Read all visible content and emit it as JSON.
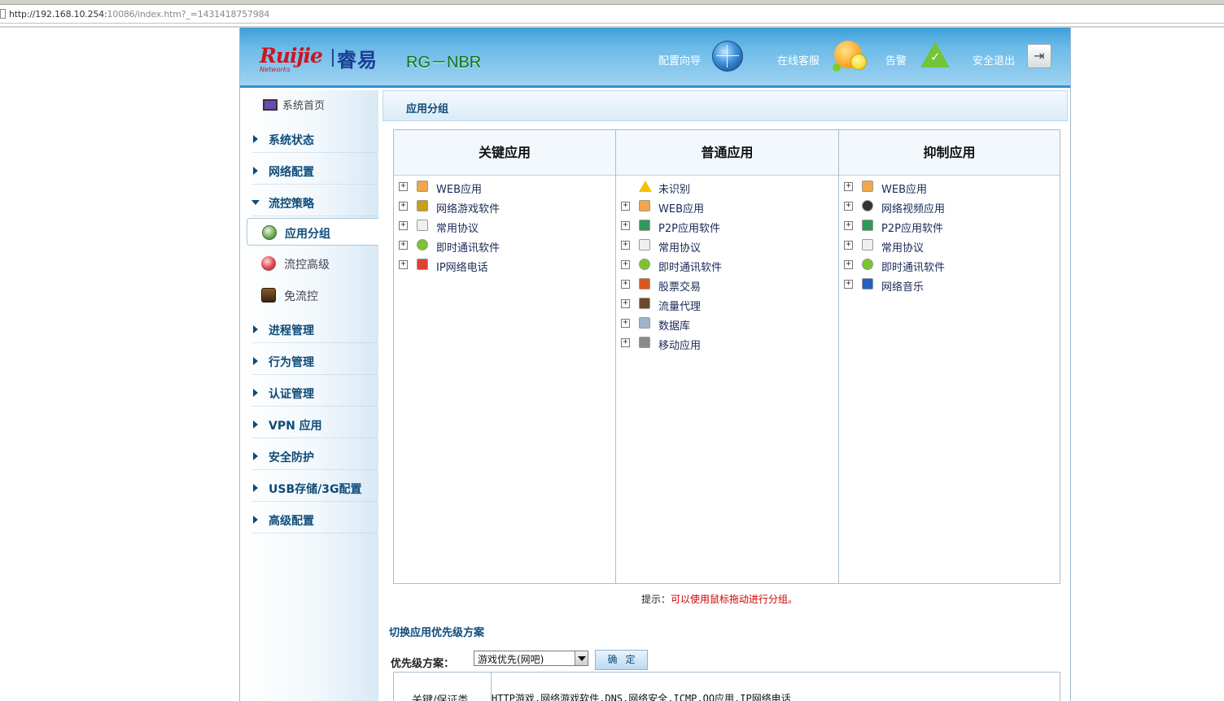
{
  "browser": {
    "url_prefix": "http://192.168.10.254:",
    "url_suffix": "10086/index.htm?_=1431418757984"
  },
  "header": {
    "brand_latin": "Ruijie",
    "brand_sub": "Networks",
    "brand_cn": "睿易",
    "model": "RG－NBR",
    "nav": {
      "wizard": "配置向导",
      "support": "在线客服",
      "alert": "告警",
      "logout": "安全退出"
    },
    "icons": [
      "globe-icon",
      "smiley-icon",
      "alert-check-icon",
      "exit-door-icon"
    ]
  },
  "sidebar": {
    "home": "系统首页",
    "items": [
      {
        "label": "系统状态"
      },
      {
        "label": "网络配置"
      },
      {
        "label": "流控策略",
        "expanded": true
      },
      {
        "label": "进程管理"
      },
      {
        "label": "行为管理"
      },
      {
        "label": "认证管理"
      },
      {
        "label": "VPN 应用"
      },
      {
        "label": "安全防护"
      },
      {
        "label": "USB存储/3G配置"
      },
      {
        "label": "高级配置"
      }
    ],
    "sub_items": [
      {
        "label": "应用分组",
        "active": true
      },
      {
        "label": "流控高级"
      },
      {
        "label": "免流控"
      }
    ]
  },
  "main": {
    "title": "应用分组",
    "columns": [
      {
        "header": "关键应用",
        "apps": [
          {
            "label": "WEB应用",
            "icon": "web-icon",
            "color": "#f2a54a"
          },
          {
            "label": "网络游戏软件",
            "icon": "game-icon",
            "color": "#c9a012"
          },
          {
            "label": "常用协议",
            "icon": "protocol-icon",
            "color": "#f0f0f0"
          },
          {
            "label": "即时通讯软件",
            "icon": "chat-icon",
            "color": "#7cc52a"
          },
          {
            "label": "IP网络电话",
            "icon": "voip-icon",
            "color": "#e04030"
          }
        ]
      },
      {
        "header": "普通应用",
        "apps": [
          {
            "label": "未识别",
            "icon": "warning-icon",
            "color": "#f2c200",
            "no_expand": true
          },
          {
            "label": "WEB应用",
            "icon": "web-icon",
            "color": "#f2a54a"
          },
          {
            "label": "P2P应用软件",
            "icon": "p2p-icon",
            "color": "#2f9a5a"
          },
          {
            "label": "常用协议",
            "icon": "protocol-icon",
            "color": "#f0f0f0"
          },
          {
            "label": "即时通讯软件",
            "icon": "chat-icon",
            "color": "#7cc52a"
          },
          {
            "label": "股票交易",
            "icon": "stock-icon",
            "color": "#d8581e"
          },
          {
            "label": "流量代理",
            "icon": "proxy-icon",
            "color": "#6a4a2a"
          },
          {
            "label": "数据库",
            "icon": "database-icon",
            "color": "#9eb4cc"
          },
          {
            "label": "移动应用",
            "icon": "mobile-icon",
            "color": "#8a8a8a"
          }
        ]
      },
      {
        "header": "抑制应用",
        "apps": [
          {
            "label": "WEB应用",
            "icon": "web-icon",
            "color": "#f2a54a"
          },
          {
            "label": "网络视频应用",
            "icon": "video-icon",
            "color": "#333333"
          },
          {
            "label": "P2P应用软件",
            "icon": "p2p-icon",
            "color": "#2f9a5a"
          },
          {
            "label": "常用协议",
            "icon": "protocol-icon",
            "color": "#f0f0f0"
          },
          {
            "label": "即时通讯软件",
            "icon": "chat-icon",
            "color": "#7cc52a"
          },
          {
            "label": "网络音乐",
            "icon": "music-icon",
            "color": "#2060c0"
          }
        ]
      }
    ],
    "tip_prefix": "提示：",
    "tip_text": "可以使用鼠标拖动进行分组。",
    "switch_title": "切换应用优先级方案",
    "plan_label": "优先级方案：",
    "plan_selected": "游戏优先(网吧)",
    "confirm_label": "确定",
    "summary_key": "关键/保证类",
    "summary_value": "HTTP游戏,网络游戏软件,DNS,网络安全,ICMP,QQ应用,IP网络电话"
  }
}
